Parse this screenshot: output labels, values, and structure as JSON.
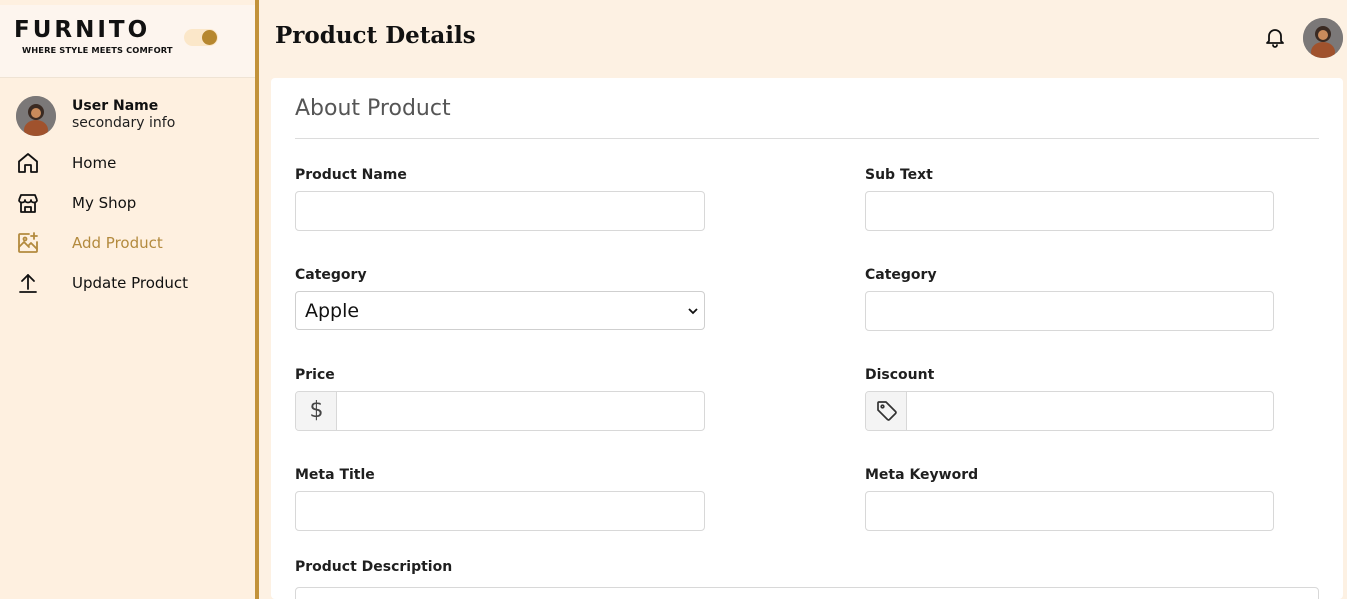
{
  "brand": {
    "logo_text": "FURNITO",
    "tagline": "WHERE STYLE MEETS COMFORT"
  },
  "theme_toggle": {
    "state": "on",
    "accent": "#b6872f"
  },
  "user": {
    "name": "User Name",
    "secondary": "secondary info"
  },
  "sidebar": {
    "items": [
      {
        "label": "Home",
        "icon": "home-icon",
        "active": false
      },
      {
        "label": "My Shop",
        "icon": "shop-icon",
        "active": false
      },
      {
        "label": "Add Product",
        "icon": "add-image-icon",
        "active": true
      },
      {
        "label": "Update Product",
        "icon": "upload-icon",
        "active": false
      }
    ]
  },
  "header": {
    "title": "Product Details",
    "bell_icon": "bell-icon"
  },
  "form": {
    "section_title": "About Product",
    "product_name": {
      "label": "Product Name",
      "value": ""
    },
    "sub_text": {
      "label": "Sub Text",
      "value": ""
    },
    "category_select": {
      "label": "Category",
      "value": "Apple"
    },
    "category_text": {
      "label": "Category",
      "value": ""
    },
    "price": {
      "label": "Price",
      "addon": "$",
      "value": ""
    },
    "discount": {
      "label": "Discount",
      "addon_icon": "tag-icon",
      "value": ""
    },
    "meta_title": {
      "label": "Meta Title",
      "value": ""
    },
    "meta_keyword": {
      "label": "Meta Keyword",
      "value": ""
    },
    "description": {
      "label": "Product Description",
      "value": ""
    }
  },
  "colors": {
    "sidebar_bg": "#fef0e0",
    "accent_gold": "#c2923a",
    "active_nav": "#b38a3e"
  }
}
